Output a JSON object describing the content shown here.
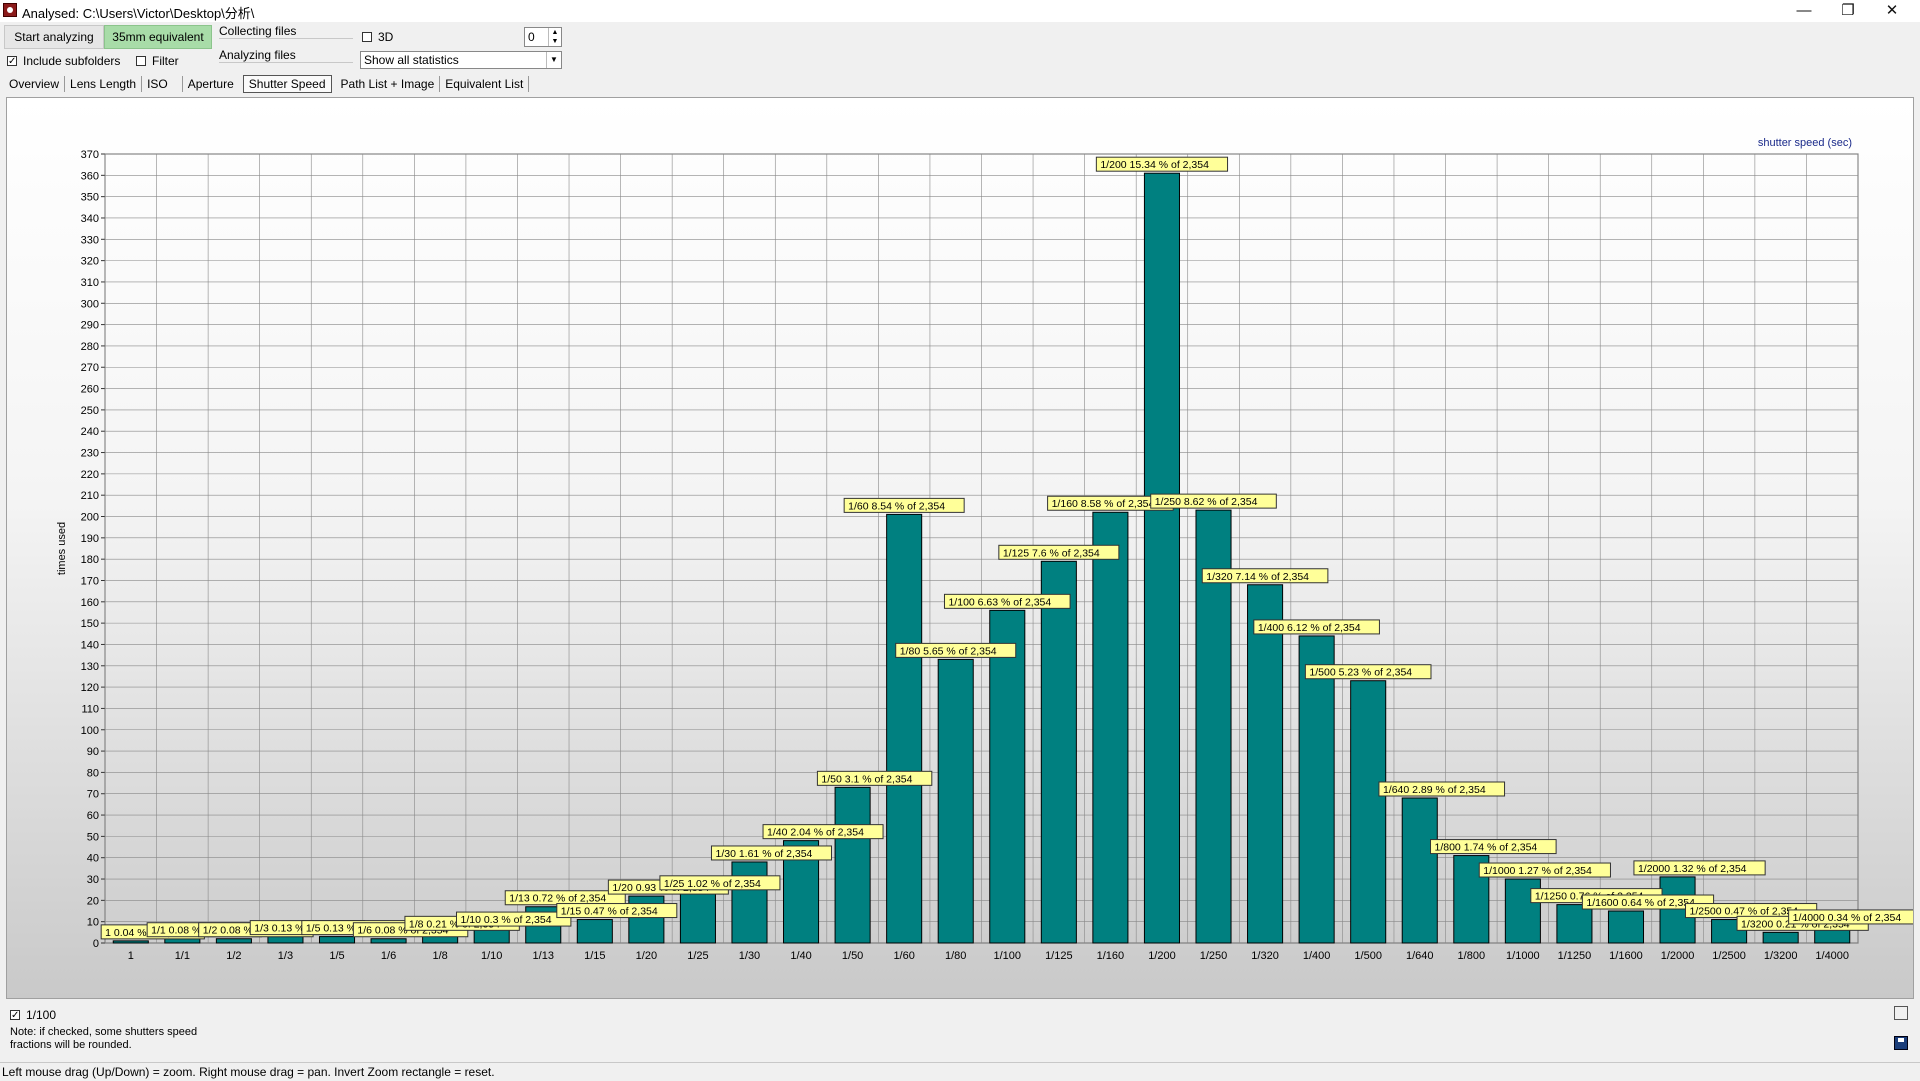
{
  "window": {
    "title": "Analysed: C:\\Users\\Victor\\Desktop\\分析\\",
    "minimize_glyph": "—",
    "restore_glyph": "❐",
    "close_glyph": "✕"
  },
  "toolbar": {
    "start_label": "Start analyzing",
    "equiv_label": "35mm equivalent",
    "collecting_label": "Collecting files",
    "analyzing_label": "Analyzing files",
    "include_subfolders_label": "Include subfolders",
    "filter_label": "Filter",
    "three_d_label": "3D",
    "spin_value": "0",
    "stats_select_value": "Show all statistics"
  },
  "tabs": [
    "Overview",
    "Lens Length",
    "ISO",
    "Aperture",
    "Shutter Speed",
    "Path List + Image",
    "Equivalent List"
  ],
  "active_tab": "Shutter Speed",
  "chart_data": {
    "type": "bar",
    "title": "shutter speed (sec)",
    "ylabel": "times used",
    "xlabel": "",
    "ylim": [
      0,
      370
    ],
    "ytick_step": 10,
    "bar_color": "#008080",
    "label_bg": "#ffff99",
    "total": "2,354",
    "categories": [
      "1",
      "1/1",
      "1/2",
      "1/3",
      "1/5",
      "1/6",
      "1/8",
      "1/10",
      "1/13",
      "1/15",
      "1/20",
      "1/25",
      "1/30",
      "1/40",
      "1/50",
      "1/60",
      "1/80",
      "1/100",
      "1/125",
      "1/160",
      "1/200",
      "1/250",
      "1/320",
      "1/400",
      "1/500",
      "1/640",
      "1/800",
      "1/1000",
      "1/1250",
      "1/1600",
      "1/2000",
      "1/2500",
      "1/3200",
      "1/4000"
    ],
    "values": [
      1,
      2,
      2,
      3,
      3,
      2,
      5,
      7,
      17,
      11,
      22,
      24,
      38,
      48,
      73,
      201,
      133,
      156,
      179,
      202,
      361,
      203,
      168,
      144,
      123,
      68,
      41,
      30,
      18,
      15,
      31,
      11,
      5,
      8
    ],
    "labels": [
      "1 0.04 % of 2,354",
      "1/1 0.08 % of 2,354",
      "1/2 0.08 % of 2,354",
      "1/3 0.13 % of 2,354",
      "1/5 0.13 % of 2,354",
      "1/6 0.08 % of 2,354",
      "1/8 0.21 % of 2,354",
      "1/10 0.3 % of 2,354",
      "1/13 0.72 % of 2,354",
      "1/15 0.47 % of 2,354",
      "1/20 0.93 % of 2,354",
      "1/25 1.02 % of 2,354",
      "1/30 1.61 % of 2,354",
      "1/40 2.04 % of 2,354",
      "1/50 3.1 % of 2,354",
      "1/60 8.54 % of 2,354",
      "1/80 5.65 % of 2,354",
      "1/100 6.63 % of 2,354",
      "1/125 7.6 % of 2,354",
      "1/160 8.58 % of 2,354",
      "1/200 15.34 % of 2,354",
      "1/250 8.62 % of 2,354",
      "1/320 7.14 % of 2,354",
      "1/400 6.12 % of 2,354",
      "1/500 5.23 % of 2,354",
      "1/640 2.89 % of 2,354",
      "1/800 1.74 % of 2,354",
      "1/1000 1.27 % of 2,354",
      "1/1250 0.76 % of 2,354",
      "1/1600 0.64 % of 2,354",
      "1/2000 1.32 % of 2,354",
      "1/2500 0.47 % of 2,354",
      "1/3200 0.21 % of 2,354",
      "1/4000 0.34 % of 2,354"
    ]
  },
  "bottom": {
    "round_checkbox_label": "1/100",
    "note_line1": "Note: if checked, some shutters speed",
    "note_line2": "fractions will be rounded."
  },
  "status": {
    "text": "Left mouse drag (Up/Down) = zoom. Right mouse drag = pan. Invert Zoom rectangle = reset."
  }
}
